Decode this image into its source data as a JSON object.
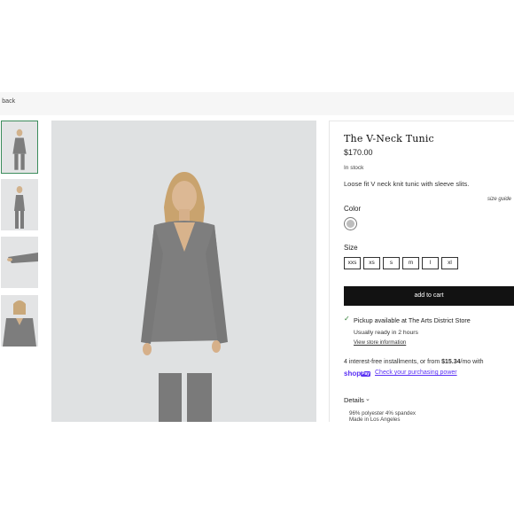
{
  "nav": {
    "back_label": "back"
  },
  "product": {
    "title": "The V-Neck Tunic",
    "price": "$170.00",
    "stock": "In stock",
    "description": "Loose fit V neck knit tunic with sleeve slits.",
    "size_guide": "size guide",
    "color_label": "Color",
    "color_swatch": "#bdbdbd",
    "size_label": "Size",
    "sizes": [
      "xxs",
      "xs",
      "s",
      "m",
      "l",
      "xl"
    ],
    "add_to_cart": "add to cart"
  },
  "pickup": {
    "check_icon": "✓",
    "prefix": "Pickup available at ",
    "store": "The Arts District Store",
    "ready": "Usually ready in 2 hours",
    "view_store": "View store information"
  },
  "installments": {
    "prefix": "4 interest-free installments, or from ",
    "amount": "$15.34",
    "suffix": "/mo with",
    "shop_logo": "shop",
    "pay_logo": "Pay",
    "check_link": "Check your purchasing power"
  },
  "details": {
    "label": "Details",
    "chevron_icon": "⌄",
    "fabric": "96% polyester 4% spandex",
    "made_in": "Made in Los Angeles"
  },
  "accent_colors": {
    "thumb_selected": "#3c8c5c",
    "shop_pay": "#5a31f4",
    "pickup_check": "#2e7d32"
  }
}
